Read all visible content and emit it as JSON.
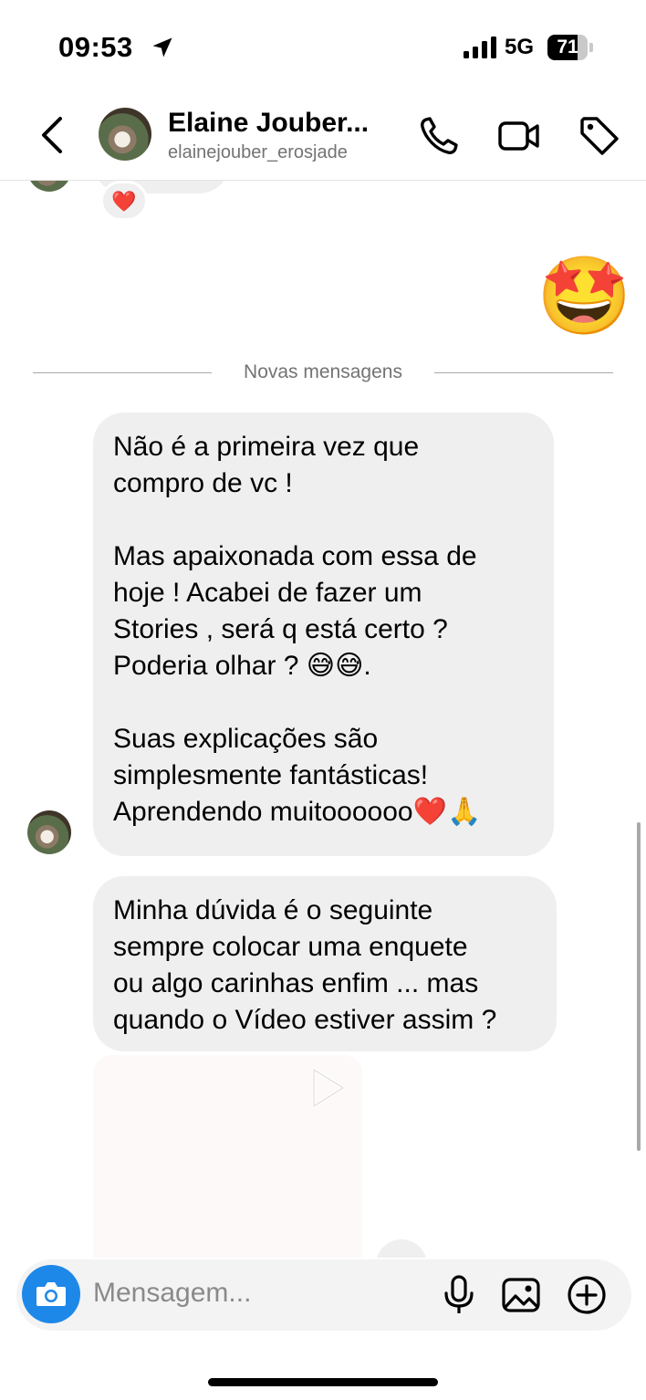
{
  "status_bar": {
    "time": "09:53",
    "network": "5G",
    "battery": "71"
  },
  "header": {
    "contact_name": "Elaine Jouber...",
    "username": "elainejouber_erosjade",
    "icons": [
      "chevron-left-icon",
      "phone-icon",
      "video-camera-icon",
      "tag-icon"
    ]
  },
  "chat": {
    "reaction": "❤️",
    "sent_emoji": "🤩",
    "divider_label": "Novas mensagens",
    "messages": [
      {
        "text": "Não é a primeira vez que\ncompro de vc !\n\nMas apaixonada com essa de\nhoje ! Acabei de fazer um\nStories , será q está certo ?\nPoderia olhar ? 😅😅.\n\nSuas explicações são\nsimplesmente fantásticas!\nAprendendo muitoooooo❤️🙏"
      },
      {
        "text": "Minha dúvida é o seguinte\nsempre colocar uma enquete\nou algo carinhas enfim ... mas\nquando o Vídeo estiver assim ?"
      }
    ]
  },
  "composer": {
    "placeholder": "Mensagem..."
  }
}
